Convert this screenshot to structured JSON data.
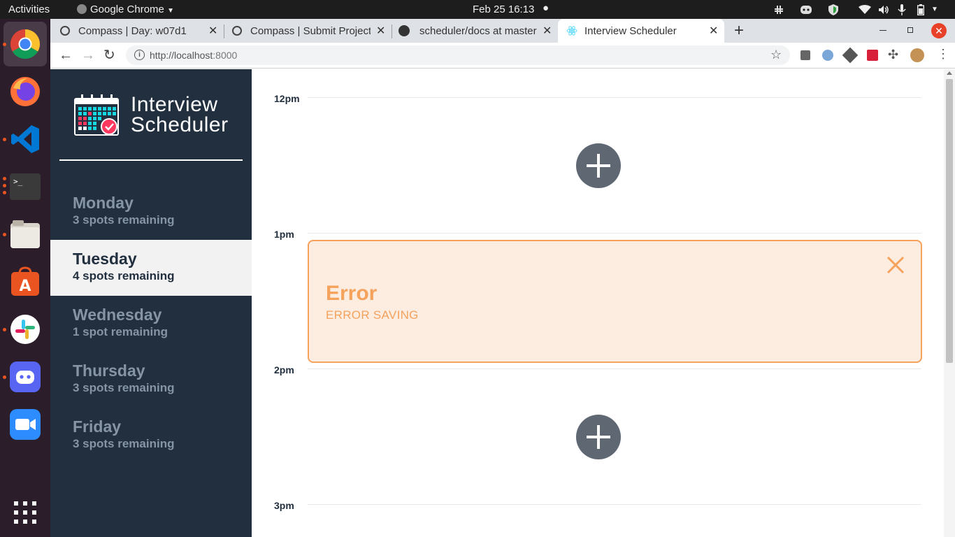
{
  "topbar": {
    "activities": "Activities",
    "app_name": "Google Chrome",
    "datetime": "Feb 25  16:13"
  },
  "browser": {
    "tabs": [
      {
        "title": "Compass | Day: w07d1"
      },
      {
        "title": "Compass | Submit Project"
      },
      {
        "title": "scheduler/docs at master"
      },
      {
        "title": "Interview Scheduler"
      }
    ],
    "url_host": "http://localhost",
    "url_port": ":8000"
  },
  "sidebar": {
    "logo_line1": "Interview",
    "logo_line2": "Scheduler",
    "days": [
      {
        "name": "Monday",
        "spots": "3 spots remaining",
        "selected": false
      },
      {
        "name": "Tuesday",
        "spots": "4 spots remaining",
        "selected": true
      },
      {
        "name": "Wednesday",
        "spots": "1 spot remaining",
        "selected": false
      },
      {
        "name": "Thursday",
        "spots": "3 spots remaining",
        "selected": false
      },
      {
        "name": "Friday",
        "spots": "3 spots remaining",
        "selected": false
      }
    ]
  },
  "schedule": {
    "slots": [
      {
        "time": "12pm"
      },
      {
        "time": "1pm"
      },
      {
        "time": "2pm"
      },
      {
        "time": "3pm"
      }
    ],
    "error": {
      "title": "Error",
      "message": "ERROR SAVING"
    }
  },
  "colors": {
    "sidebar_bg": "#222f3e",
    "error_accent": "#f5a25d",
    "error_bg": "#fdece0",
    "add_button": "#5f6773"
  }
}
